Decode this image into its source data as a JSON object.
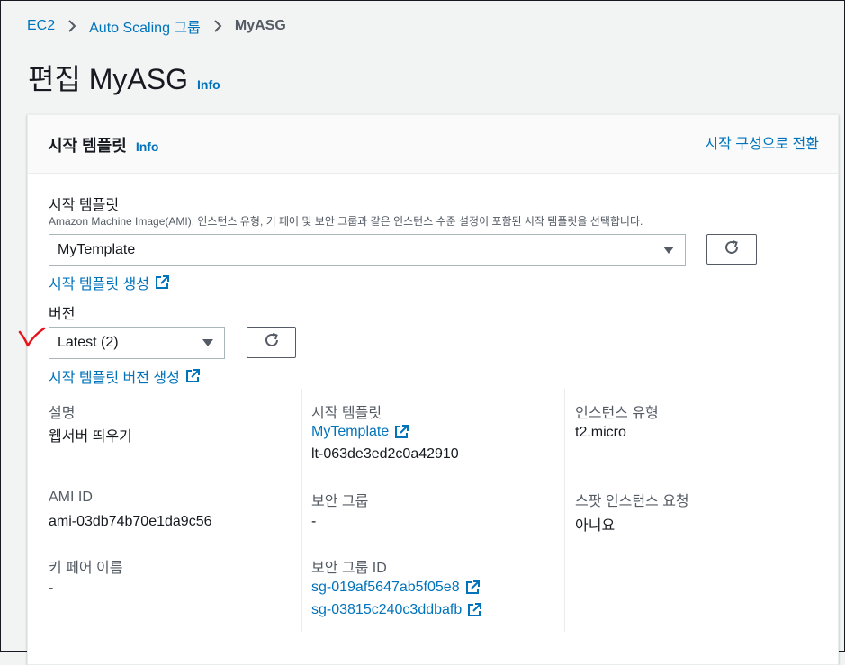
{
  "breadcrumb": {
    "items": [
      "EC2",
      "Auto Scaling 그룹"
    ],
    "current": "MyASG"
  },
  "page": {
    "title": "편집 MyASG",
    "info": "Info"
  },
  "panel": {
    "title": "시작 템플릿",
    "info": "Info",
    "switch_link": "시작 구성으로 전환",
    "template_label": "시작 템플릿",
    "template_desc": "Amazon Machine Image(AMI), 인스턴스 유형, 키 페어 및 보안 그룹과 같은 인스턴스 수준 설정이 포함된 시작 템플릿을 선택합니다.",
    "template_value": "MyTemplate",
    "create_template_link": "시작 템플릿 생성",
    "version_label": "버전",
    "version_value": "Latest (2)",
    "create_version_link": "시작 템플릿 버전 생성"
  },
  "details": {
    "description": {
      "label": "설명",
      "value": "웹서버 띄우기"
    },
    "launch_template": {
      "label": "시작 템플릿",
      "link": "MyTemplate",
      "id": "lt-063de3ed2c0a42910"
    },
    "instance_type": {
      "label": "인스턴스 유형",
      "value": "t2.micro"
    },
    "ami_id": {
      "label": "AMI ID",
      "value": "ami-03db74b70e1da9c56"
    },
    "security_group": {
      "label": "보안 그룹",
      "value": "-"
    },
    "spot_request": {
      "label": "스팟 인스턴스 요청",
      "value": "아니요"
    },
    "key_pair": {
      "label": "키 페어 이름",
      "value": "-"
    },
    "security_group_ids": {
      "label": "보안 그룹 ID",
      "ids": [
        "sg-019af5647ab5f05e8",
        "sg-03815c240c3ddbafb"
      ]
    }
  },
  "colors": {
    "link": "#0073bb",
    "text": "#16191f",
    "muted": "#545b64",
    "annotation": "#e8131a"
  },
  "icons": [
    "chevron-right-icon",
    "refresh-icon",
    "external-link-icon",
    "caret-down-icon",
    "check-annotation-icon"
  ]
}
